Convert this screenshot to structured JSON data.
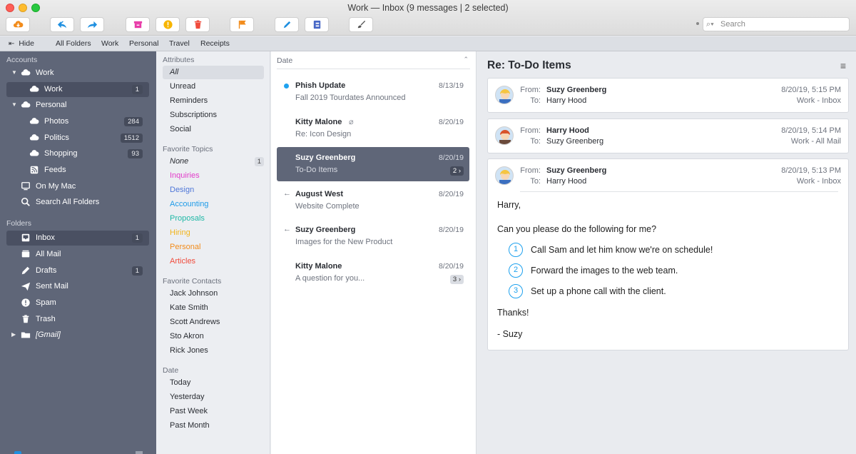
{
  "window": {
    "title": "Work — Inbox (9 messages | 2 selected)"
  },
  "toolbar": {
    "buttons": [
      {
        "name": "get-mail",
        "icon": "cloud-download-icon",
        "color": "#f28c1c"
      },
      {
        "name": "reply-all",
        "icon": "reply-all-icon",
        "color": "#1e8fe0"
      },
      {
        "name": "forward",
        "icon": "forward-icon",
        "color": "#1e8fe0"
      },
      {
        "name": "archive",
        "icon": "archive-icon",
        "color": "#e83ba8"
      },
      {
        "name": "spam",
        "icon": "exclamation-icon",
        "color": "#f7b500"
      },
      {
        "name": "trash",
        "icon": "trash-icon",
        "color": "#f04b3c"
      },
      {
        "name": "flag",
        "icon": "flag-icon",
        "color": "#f28c1c"
      },
      {
        "name": "compose",
        "icon": "pencil-icon",
        "color": "#1e8fe0"
      },
      {
        "name": "address-book",
        "icon": "address-book-icon",
        "color": "#4767c6"
      },
      {
        "name": "brush",
        "icon": "brush-icon",
        "color": "#555555"
      }
    ],
    "search_placeholder": "Search"
  },
  "favorites_bar": {
    "hide_label": "Hide",
    "items": [
      "All Folders",
      "Work",
      "Personal",
      "Travel",
      "Receipts"
    ]
  },
  "sidebar": {
    "accounts_header": "Accounts",
    "work_account": "Work",
    "work_inbox": {
      "label": "Work",
      "count": "1"
    },
    "personal_account": "Personal",
    "personal_items": [
      {
        "label": "Photos",
        "count": "284"
      },
      {
        "label": "Politics",
        "count": "1512"
      },
      {
        "label": "Shopping",
        "count": "93"
      },
      {
        "label": "Feeds",
        "count": ""
      }
    ],
    "on_my_mac": "On My Mac",
    "search_all": "Search All Folders",
    "folders_header": "Folders",
    "folders": [
      {
        "label": "Inbox",
        "count": "1",
        "icon": "inbox-icon"
      },
      {
        "label": "All Mail",
        "count": "",
        "icon": "all-mail-icon"
      },
      {
        "label": "Drafts",
        "count": "1",
        "icon": "pencil-icon"
      },
      {
        "label": "Sent Mail",
        "count": "",
        "icon": "paper-plane-icon"
      },
      {
        "label": "Spam",
        "count": "",
        "icon": "exclamation-icon"
      },
      {
        "label": "Trash",
        "count": "",
        "icon": "trash-icon"
      }
    ],
    "gmail": "[Gmail]"
  },
  "attributes": {
    "header": "Attributes",
    "items": [
      "All",
      "Unread",
      "Reminders",
      "Subscriptions",
      "Social"
    ],
    "topics_header": "Favorite Topics",
    "topics": [
      {
        "label": "None",
        "color": "#2a2d33",
        "count": "1"
      },
      {
        "label": "Inquiries",
        "color": "#e23bc9",
        "count": ""
      },
      {
        "label": "Design",
        "color": "#4f77d8",
        "count": ""
      },
      {
        "label": "Accounting",
        "color": "#1e9be8",
        "count": ""
      },
      {
        "label": "Proposals",
        "color": "#1fb8a6",
        "count": ""
      },
      {
        "label": "Hiring",
        "color": "#f2b51c",
        "count": ""
      },
      {
        "label": "Personal",
        "color": "#f28c1c",
        "count": ""
      },
      {
        "label": "Articles",
        "color": "#f04b3c",
        "count": ""
      }
    ],
    "contacts_header": "Favorite Contacts",
    "contacts": [
      "Jack Johnson",
      "Kate Smith",
      "Scott Andrews",
      "Sto Akron",
      "Rick Jones"
    ],
    "date_header": "Date",
    "dates": [
      "Today",
      "Yesterday",
      "Past Week",
      "Past Month"
    ]
  },
  "message_list": {
    "sort_label": "Date",
    "messages": [
      {
        "from": "Phish Update",
        "subject": "Fall 2019 Tourdates Announced",
        "date": "8/13/19",
        "unread": true
      },
      {
        "from": "Kitty Malone",
        "subject": "Re: Icon Design",
        "date": "8/20/19",
        "attachment": true
      },
      {
        "from": "Suzy Greenberg",
        "subject": "To-Do Items",
        "date": "8/20/19",
        "thread": "2",
        "selected": true
      },
      {
        "from": "August West",
        "subject": "Website Complete",
        "date": "8/20/19",
        "replied": true
      },
      {
        "from": "Suzy Greenberg",
        "subject": "Images for the New Product",
        "date": "8/20/19",
        "replied": true
      },
      {
        "from": "Kitty Malone",
        "subject": "A question for you...",
        "date": "8/20/19",
        "thread": "3"
      }
    ]
  },
  "reader": {
    "title": "Re: To-Do Items",
    "from_label": "From:",
    "to_label": "To:",
    "cards": [
      {
        "from": "Suzy Greenberg",
        "to": "Harry Hood",
        "date": "8/20/19, 5:15 PM",
        "folder": "Work - Inbox"
      },
      {
        "from": "Harry Hood",
        "to": "Suzy Greenberg",
        "date": "8/20/19, 5:14 PM",
        "folder": "Work - All Mail"
      },
      {
        "from": "Suzy Greenberg",
        "to": "Harry Hood",
        "date": "8/20/19, 5:13 PM",
        "folder": "Work - Inbox"
      }
    ],
    "body": {
      "greeting": "Harry,",
      "intro": "Can you please do the following for me?",
      "items": [
        {
          "num": "1",
          "text": "Call Sam and let him know we're on schedule!"
        },
        {
          "num": "2",
          "text": "Forward the images to the web team."
        },
        {
          "num": "3",
          "text": "Set up a phone call with the client."
        }
      ],
      "thanks": "Thanks!",
      "signature": "- Suzy"
    }
  }
}
